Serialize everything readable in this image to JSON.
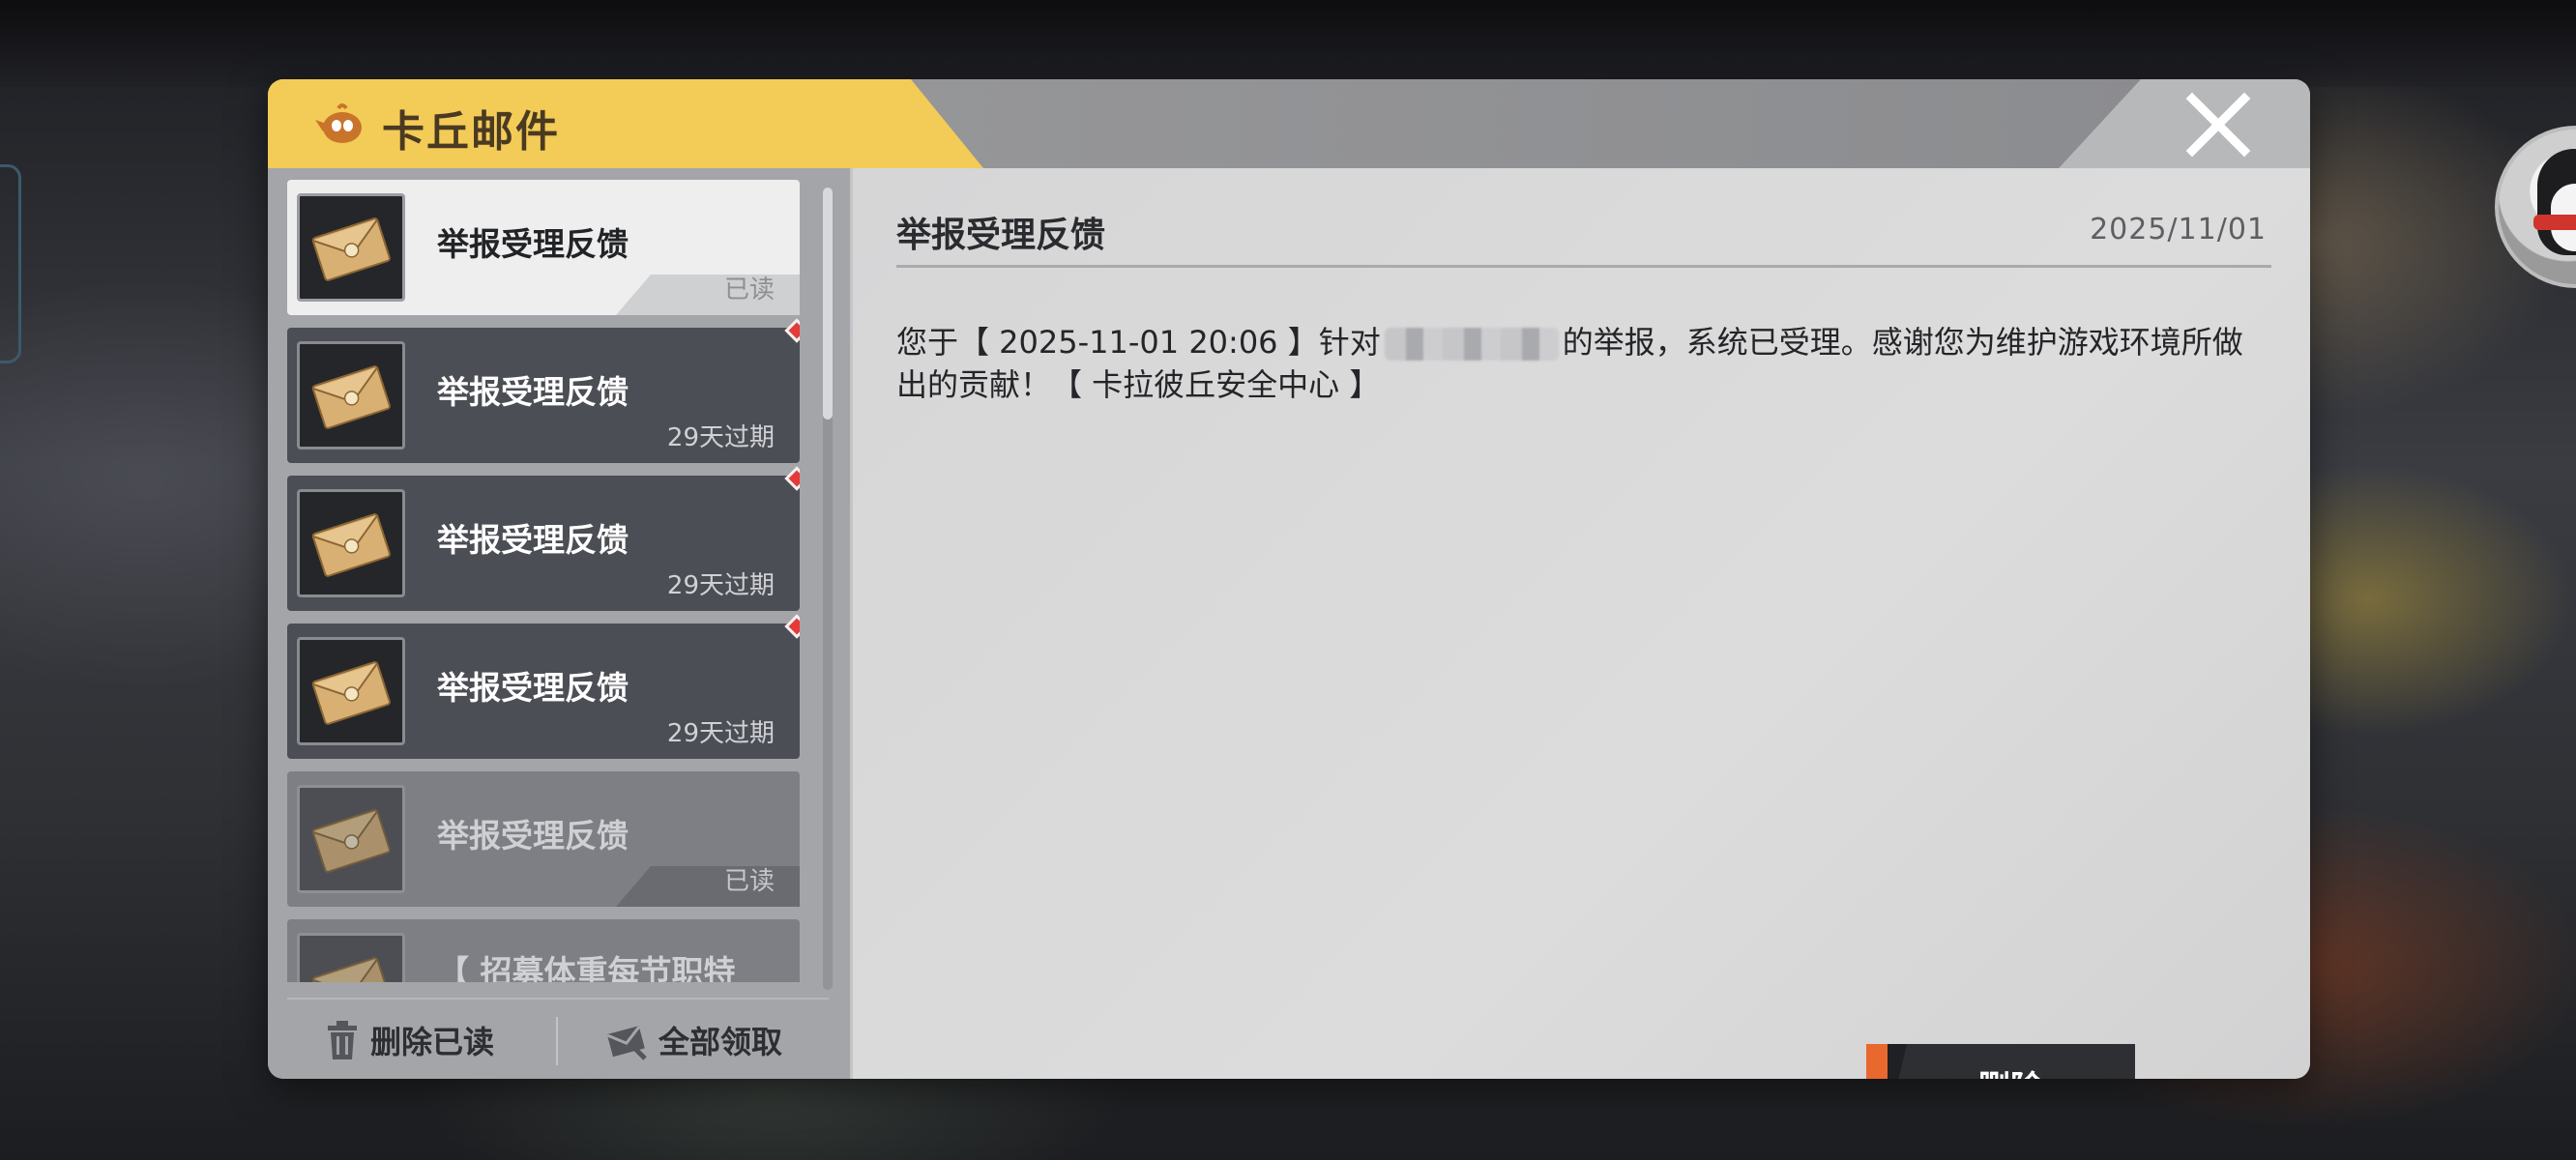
{
  "header": {
    "title": "卡丘邮件"
  },
  "mail_list": {
    "items": [
      {
        "title": "举报受理反馈",
        "status": "已读",
        "state": "selected",
        "unread": false
      },
      {
        "title": "举报受理反馈",
        "status": "29天过期",
        "state": "unread",
        "unread": true
      },
      {
        "title": "举报受理反馈",
        "status": "29天过期",
        "state": "unread",
        "unread": true
      },
      {
        "title": "举报受理反馈",
        "status": "29天过期",
        "state": "unread",
        "unread": true
      },
      {
        "title": "举报受理反馈",
        "status": "已读",
        "state": "read",
        "unread": false
      },
      {
        "title": "【 招募体重每节职特",
        "status": "",
        "state": "read",
        "unread": false
      }
    ],
    "footer": {
      "delete_read_label": "删除已读",
      "claim_all_label": "全部领取"
    }
  },
  "detail": {
    "title": "举报受理反馈",
    "date": "2025/11/01",
    "body_part1": "您于【 2025-11-01 20:06 】针对",
    "body_part2": "的举报，系统已受理。感谢您为维护游戏环境所做出的贡献！【 卡拉彼丘安全中心 】",
    "delete_label": "删除"
  },
  "colors": {
    "header_tab": "#f3cb57",
    "accent_orange": "#e8682e",
    "unread_dot": "#e53a3a"
  }
}
